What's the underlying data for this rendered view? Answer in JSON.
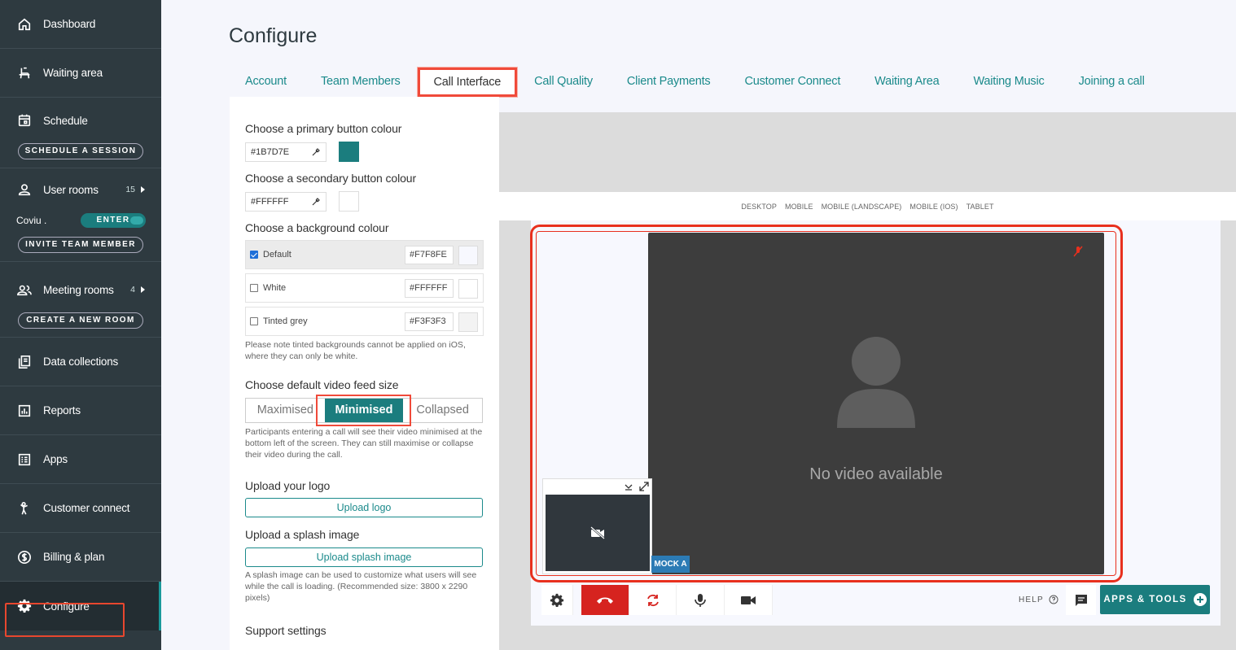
{
  "sidebar": {
    "dashboard": "Dashboard",
    "waiting_area": "Waiting area",
    "schedule": "Schedule",
    "schedule_btn": "SCHEDULE A SESSION",
    "user_rooms": "User rooms",
    "user_rooms_count": "15",
    "coviu_name": "Coviu .",
    "enter_btn": "ENTER",
    "invite_btn": "INVITE TEAM MEMBER",
    "meeting_rooms": "Meeting rooms",
    "meeting_rooms_count": "4",
    "create_room_btn": "CREATE A NEW ROOM",
    "data_collections": "Data collections",
    "reports": "Reports",
    "apps": "Apps",
    "customer_connect": "Customer connect",
    "billing": "Billing & plan",
    "configure": "Configure"
  },
  "header": {
    "title": "Configure",
    "tabs": [
      "Account",
      "Team Members",
      "Call Interface",
      "Call Quality",
      "Client Payments",
      "Customer Connect",
      "Waiting Area",
      "Waiting Music",
      "Joining a call"
    ],
    "active_tab": "Call Interface"
  },
  "settings": {
    "primary_label": "Choose a primary button colour",
    "primary_value": "#1B7D7E",
    "secondary_label": "Choose a secondary button colour",
    "secondary_value": "#FFFFFF",
    "background_label": "Choose a background colour",
    "bg_options": [
      {
        "label": "Default",
        "hex": "#F7F8FE",
        "checked": true
      },
      {
        "label": "White",
        "hex": "#FFFFFF",
        "checked": false
      },
      {
        "label": "Tinted grey",
        "hex": "#F3F3F3",
        "checked": false
      }
    ],
    "bg_note": "Please note tinted backgrounds cannot be applied on iOS, where they can only be white.",
    "feed_label": "Choose default video feed size",
    "feed_options": [
      "Maximised",
      "Minimised",
      "Collapsed"
    ],
    "feed_selected": "Minimised",
    "feed_note": "Participants entering a call will see their video minimised at the bottom left of the screen. They can still maximise or collapse their video during the call.",
    "logo_label": "Upload your logo",
    "logo_btn": "Upload logo",
    "splash_label": "Upload a splash image",
    "splash_btn": "Upload splash image",
    "splash_note": "A splash image can be used to customize what users will see while the call is loading. (Recommended size: 3800 x 2290 pixels)",
    "support_label": "Support settings"
  },
  "preview": {
    "devices": [
      "DESKTOP",
      "MOBILE",
      "MOBILE (LANDSCAPE)",
      "MOBILE (IOS)",
      "TABLET"
    ],
    "no_video": "No video available",
    "participant": "MOCK A",
    "help": "HELP",
    "apps_tools": "APPS & TOOLS"
  },
  "colors": {
    "sidebar_bg": "#2E3A40",
    "primary": "#1B7D7E",
    "highlight": "#E8472E",
    "hangup": "#D6231F"
  }
}
